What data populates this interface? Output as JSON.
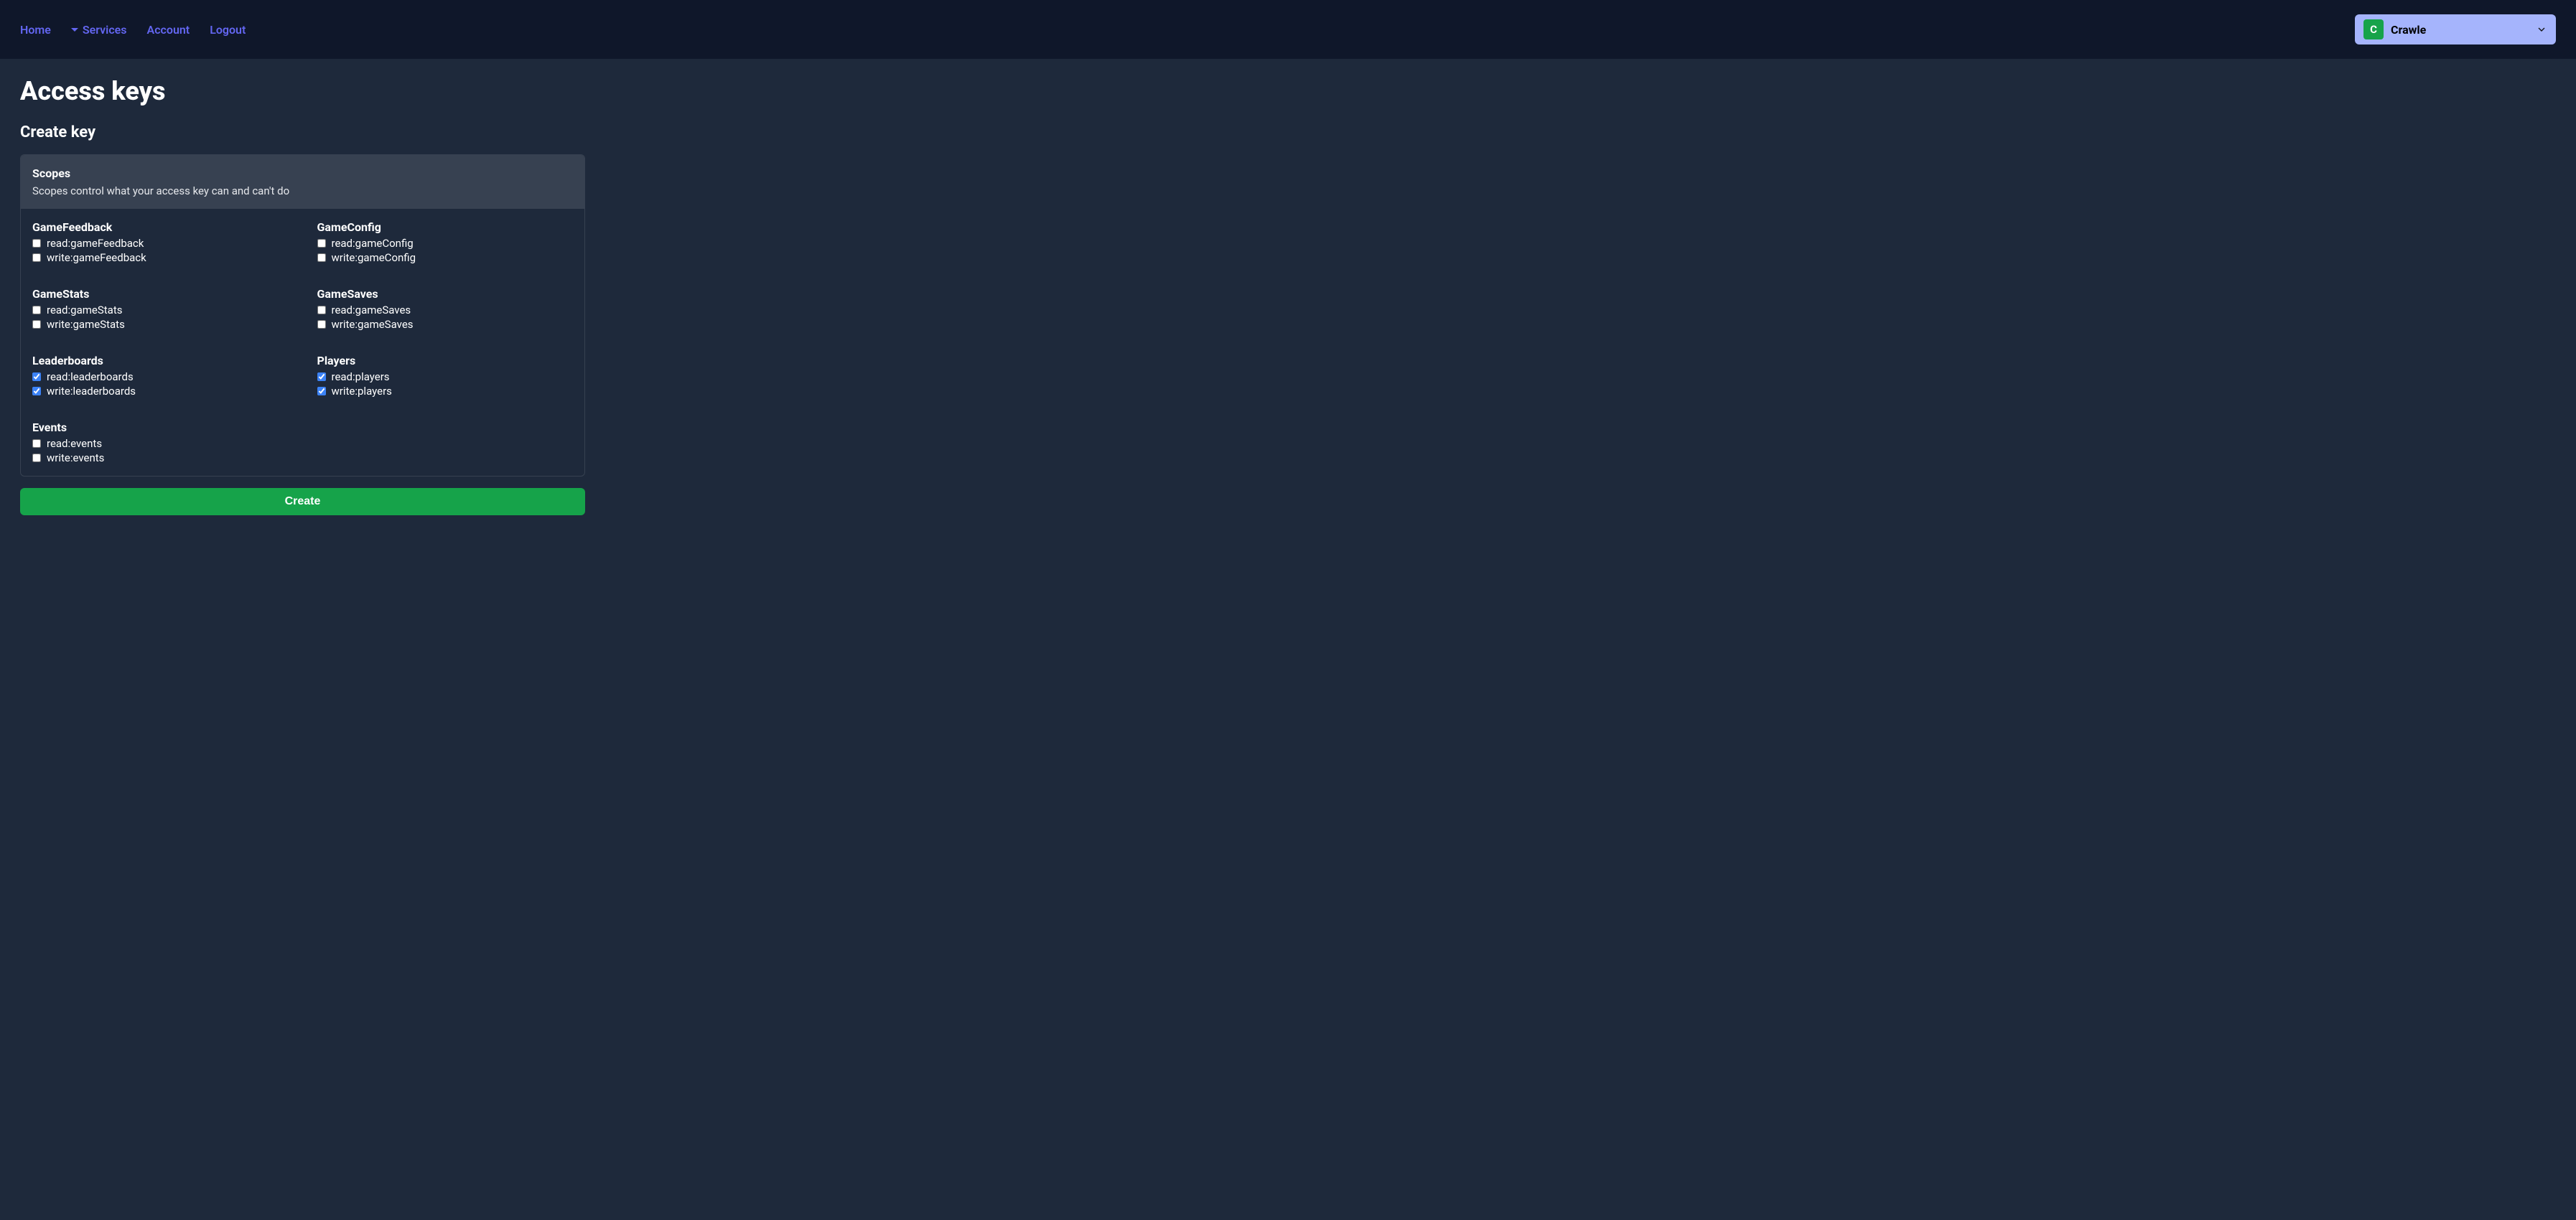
{
  "nav": {
    "home": "Home",
    "services": "Services",
    "account": "Account",
    "logout": "Logout"
  },
  "game_selector": {
    "avatar_letter": "C",
    "name": "Crawle"
  },
  "page": {
    "title": "Access keys",
    "subheading": "Create key",
    "scopes_title": "Scopes",
    "scopes_desc": "Scopes control what your access key can and can't do",
    "create_button": "Create"
  },
  "scope_groups": [
    {
      "title": "GameFeedback",
      "scopes": [
        {
          "label": "read:gameFeedback",
          "checked": false
        },
        {
          "label": "write:gameFeedback",
          "checked": false
        }
      ]
    },
    {
      "title": "GameConfig",
      "scopes": [
        {
          "label": "read:gameConfig",
          "checked": false
        },
        {
          "label": "write:gameConfig",
          "checked": false
        }
      ]
    },
    {
      "title": "GameStats",
      "scopes": [
        {
          "label": "read:gameStats",
          "checked": false
        },
        {
          "label": "write:gameStats",
          "checked": false
        }
      ]
    },
    {
      "title": "GameSaves",
      "scopes": [
        {
          "label": "read:gameSaves",
          "checked": false
        },
        {
          "label": "write:gameSaves",
          "checked": false
        }
      ]
    },
    {
      "title": "Leaderboards",
      "scopes": [
        {
          "label": "read:leaderboards",
          "checked": true
        },
        {
          "label": "write:leaderboards",
          "checked": true
        }
      ]
    },
    {
      "title": "Players",
      "scopes": [
        {
          "label": "read:players",
          "checked": true
        },
        {
          "label": "write:players",
          "checked": true
        }
      ]
    },
    {
      "title": "Events",
      "scopes": [
        {
          "label": "read:events",
          "checked": false
        },
        {
          "label": "write:events",
          "checked": false
        }
      ]
    }
  ]
}
